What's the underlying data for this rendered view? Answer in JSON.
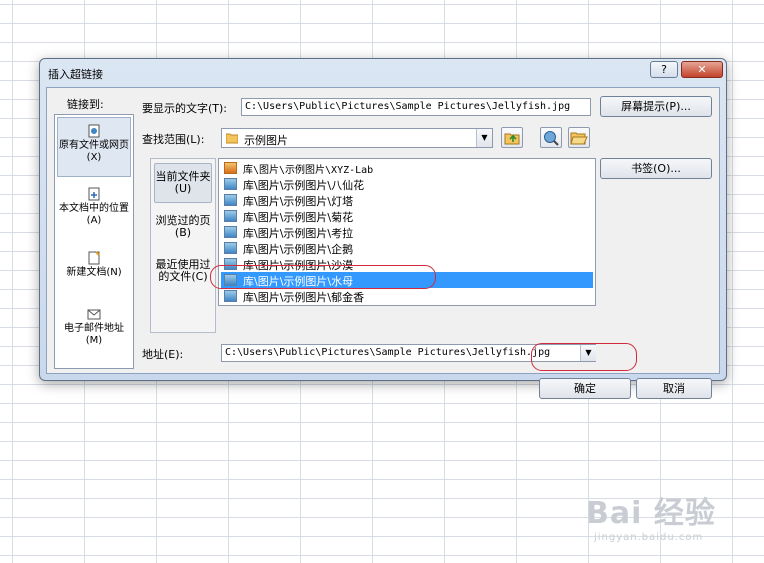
{
  "dialog": {
    "title": "插入超链接",
    "help": "?",
    "close": "✕"
  },
  "link_to": {
    "label": "链接到:",
    "items": [
      {
        "label": "原有文件或网页(X)",
        "icon": "web-page-icon",
        "selected": true
      },
      {
        "label": "本文档中的位置(A)",
        "icon": "document-location-icon",
        "selected": false
      },
      {
        "label": "新建文档(N)",
        "icon": "new-document-icon",
        "selected": false
      },
      {
        "label": "电子邮件地址(M)",
        "icon": "email-icon",
        "selected": false
      }
    ]
  },
  "display_text": {
    "label": "要显示的文字(T):",
    "value": "C:\\Users\\Public\\Pictures\\Sample Pictures\\Jellyfish.jpg"
  },
  "screen_tip": "屏幕提示(P)...",
  "look_in": {
    "label": "查找范围(L):",
    "value": "示例图片"
  },
  "bookmark": "书签(O)...",
  "nav": [
    {
      "label": "当前文件夹(U)",
      "selected": true
    },
    {
      "label": "浏览过的页(B)",
      "selected": false
    },
    {
      "label": "最近使用过的文件(C)",
      "selected": false
    }
  ],
  "files": [
    {
      "name": "库\\图片\\示例图片\\XYZ-Lab",
      "icon": "folder-file-icon",
      "selected": false
    },
    {
      "name": "库\\图片\\示例图片\\八仙花",
      "icon": "image-file-icon",
      "selected": false
    },
    {
      "name": "库\\图片\\示例图片\\灯塔",
      "icon": "image-file-icon",
      "selected": false
    },
    {
      "name": "库\\图片\\示例图片\\菊花",
      "icon": "image-file-icon",
      "selected": false
    },
    {
      "name": "库\\图片\\示例图片\\考拉",
      "icon": "image-file-icon",
      "selected": false
    },
    {
      "name": "库\\图片\\示例图片\\企鹅",
      "icon": "image-file-icon",
      "selected": false
    },
    {
      "name": "库\\图片\\示例图片\\沙漠",
      "icon": "image-file-icon",
      "selected": false
    },
    {
      "name": "库\\图片\\示例图片\\水母",
      "icon": "image-file-icon",
      "selected": true
    },
    {
      "name": "库\\图片\\示例图片\\郁金香",
      "icon": "image-file-icon",
      "selected": false
    }
  ],
  "address": {
    "label": "地址(E):",
    "value": "C:\\Users\\Public\\Pictures\\Sample Pictures\\Jellyfish.jpg"
  },
  "ok": "确定",
  "cancel": "取消",
  "watermark": {
    "brand": "Bai 经验",
    "url": "jingyan.baidu.com"
  },
  "colors": {
    "selection": "#3399ff",
    "highlight_ring": "#cf2b3c"
  }
}
